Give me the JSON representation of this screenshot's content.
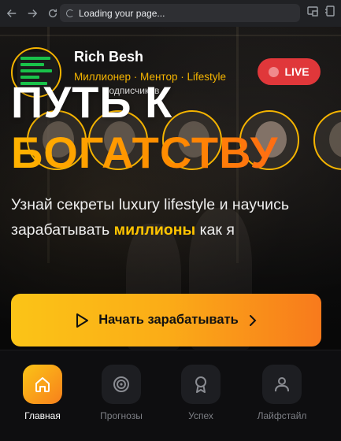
{
  "browser": {
    "address_text": "Loading your page...",
    "icons": [
      "back-arrow-icon",
      "forward-arrow-icon",
      "reload-icon",
      "cast-icon",
      "extensions-icon"
    ]
  },
  "profile": {
    "name": "Rich Besh",
    "tagline": "Миллионер · Ментор · Lifestyle",
    "subscribers_partial": "подписчиков"
  },
  "live_badge": {
    "label": "LIVE",
    "color": "#e0373a"
  },
  "headline": {
    "line1": "ПУТЬ К",
    "line2": "БОГАТСТВУ"
  },
  "description": {
    "before": "Узнай секреты luxury lifestyle и научись зарабатывать ",
    "highlight": "миллионы",
    "after": " как я"
  },
  "cta": {
    "label": "Начать зарабатывать",
    "icons": [
      "play-icon",
      "chevron-right-icon"
    ]
  },
  "bottom_nav": {
    "items": [
      {
        "label": "Главная",
        "icon": "home-icon",
        "active": true
      },
      {
        "label": "Прогнозы",
        "icon": "target-icon",
        "active": false
      },
      {
        "label": "Успех",
        "icon": "award-icon",
        "active": false
      },
      {
        "label": "Лайфстайл",
        "icon": "user-icon",
        "active": false
      }
    ]
  },
  "colors": {
    "accent_yellow": "#f5b400",
    "accent_orange": "#f8801c",
    "live_red": "#e0373a",
    "background": "#0b0b0d"
  }
}
